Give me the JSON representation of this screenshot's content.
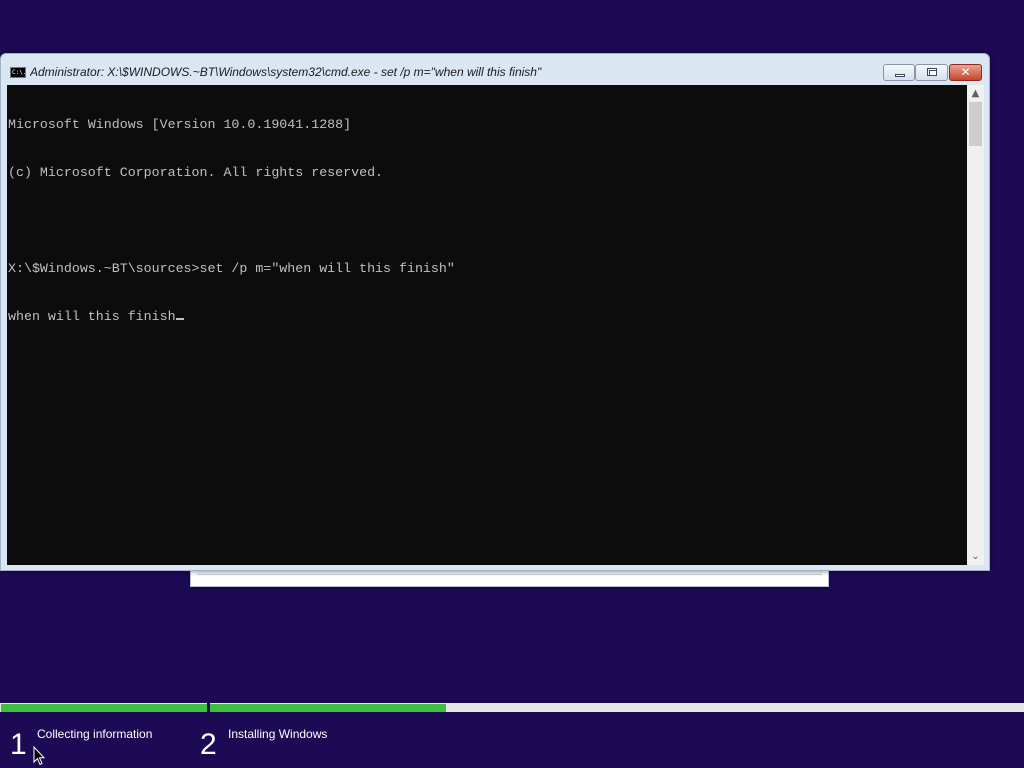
{
  "console": {
    "title": "Administrator: X:\\$WINDOWS.~BT\\Windows\\system32\\cmd.exe - set  /p m=\"when will this finish\"",
    "icon": "cmd-icon",
    "icon_text": "C:\\.",
    "lines": [
      "Microsoft Windows [Version 10.0.19041.1288]",
      "(c) Microsoft Corporation. All rights reserved.",
      "",
      "X:\\$Windows.~BT\\sources>set /p m=\"when will this finish\"",
      "when will this finish"
    ],
    "controls": {
      "minimize": "minimize-icon",
      "maximize": "maximize-icon",
      "close": "close-icon",
      "close_glyph": "✕"
    },
    "scrollbar": {
      "up_glyph": "▲",
      "down_glyph": "⌄"
    }
  },
  "setup": {
    "steps": [
      {
        "number": "1",
        "label": "Collecting information"
      },
      {
        "number": "2",
        "label": "Installing Windows"
      }
    ],
    "progress": {
      "step1_fraction": 1.0,
      "step2_fraction": 0.29
    }
  },
  "colors": {
    "background": "#1d0a55",
    "progress_fill": "#3fbf3f",
    "console_bg": "#0c0c0c",
    "console_fg": "#c0c0c0"
  }
}
